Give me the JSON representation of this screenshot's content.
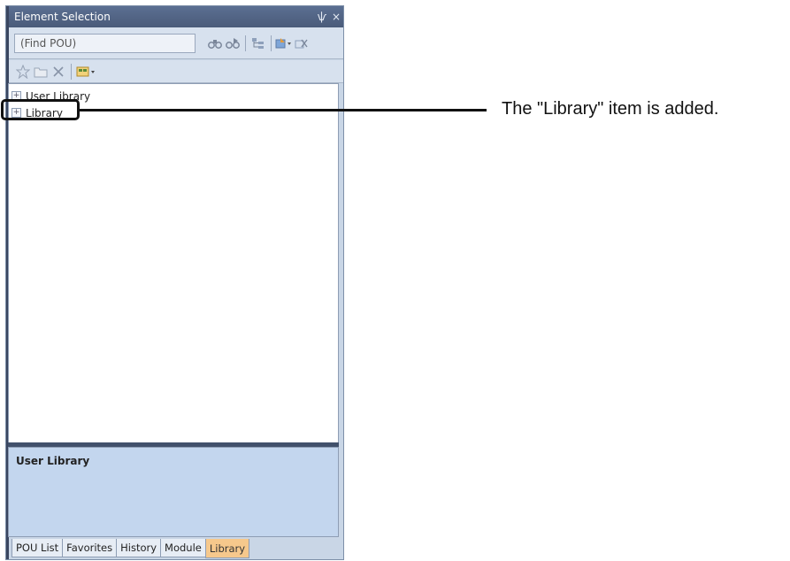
{
  "panel": {
    "title": "Element Selection",
    "pin_glyph": "ѱ",
    "close_glyph": "×"
  },
  "search": {
    "placeholder": "(Find POU)"
  },
  "toolbar": {
    "icons": [
      "binoculars-icon",
      "binoculars-next-icon",
      "tree-icon",
      "import-icon",
      "remove-icon"
    ]
  },
  "toolbar2": {
    "icons": [
      "star-icon",
      "folder-icon",
      "delete-icon",
      "library-tool-icon"
    ]
  },
  "tree": {
    "items": [
      {
        "label": "User Library",
        "expander": "+"
      },
      {
        "label": "Library",
        "expander": "+"
      }
    ]
  },
  "description": {
    "text": "User Library"
  },
  "tabs": [
    {
      "label": "POU List",
      "active": false
    },
    {
      "label": "Favorites",
      "active": false
    },
    {
      "label": "History",
      "active": false
    },
    {
      "label": "Module",
      "active": false
    },
    {
      "label": "Library",
      "active": true
    }
  ],
  "callout": {
    "text": "The \"Library\" item is added."
  }
}
